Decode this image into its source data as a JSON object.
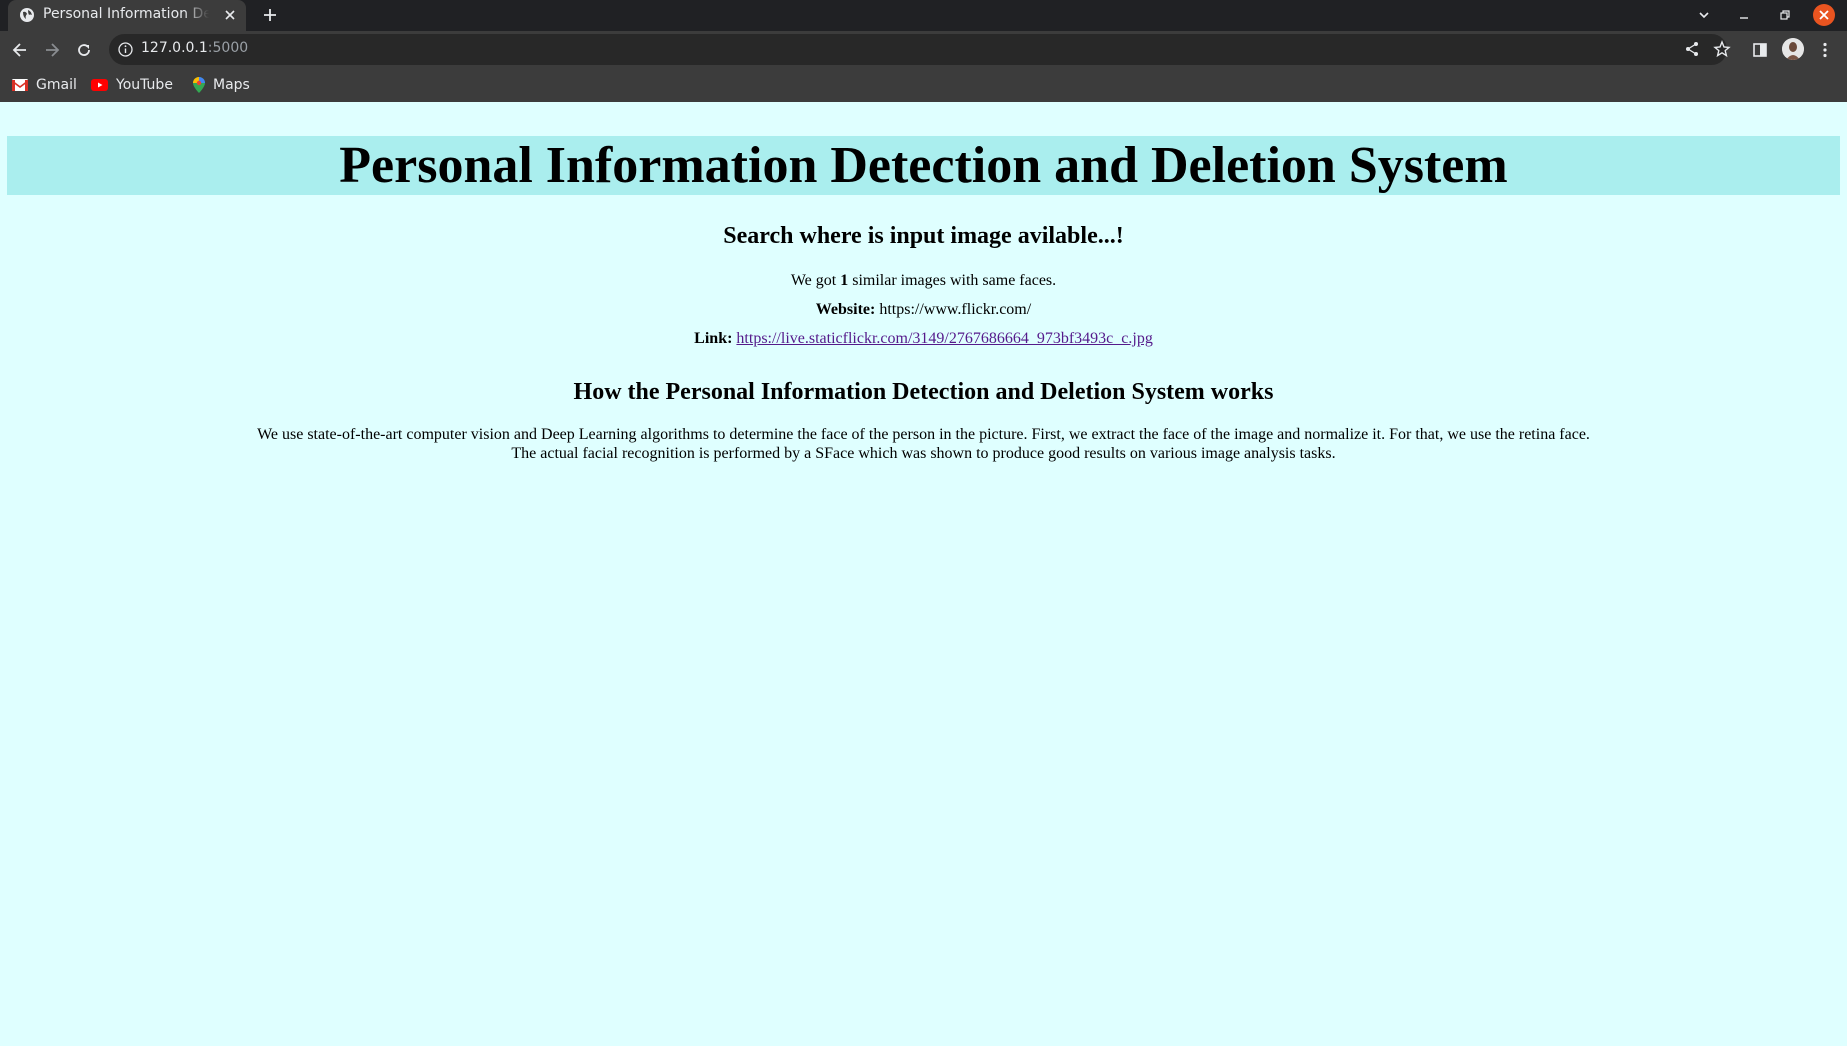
{
  "browser": {
    "tab_title": "Personal Information Detection and Deletion System",
    "url_host": "127.0.0.1",
    "url_port": ":5000",
    "bookmarks": [
      {
        "label": "Gmail"
      },
      {
        "label": "YouTube"
      },
      {
        "label": "Maps"
      }
    ]
  },
  "page": {
    "title": "Personal Information Detection and Deletion System",
    "search_heading": "Search where is input image avilable...!",
    "result_prefix": "We got",
    "result_count": "1",
    "result_suffix": "similar images with same faces.",
    "website_label": "Website:",
    "website_value": "https://www.flickr.com/",
    "link_label": "Link:",
    "link_value": "https://live.staticflickr.com/3149/2767686664_973bf3493c_c.jpg",
    "how_heading": "How the Personal Information Detection and Deletion System works",
    "description_line1": "We use state-of-the-art computer vision and Deep Learning algorithms to determine the face of the person in the picture. First, we extract the face of the image and normalize it. For that, we use the retina face.",
    "description_line2": "The actual facial recognition is performed by a SFace which was shown to produce good results on various image analysis tasks."
  },
  "colors": {
    "page_background": "#dfffff",
    "header_band": "#aaeeee",
    "link": "#551a8b",
    "window_close": "#e95420"
  }
}
